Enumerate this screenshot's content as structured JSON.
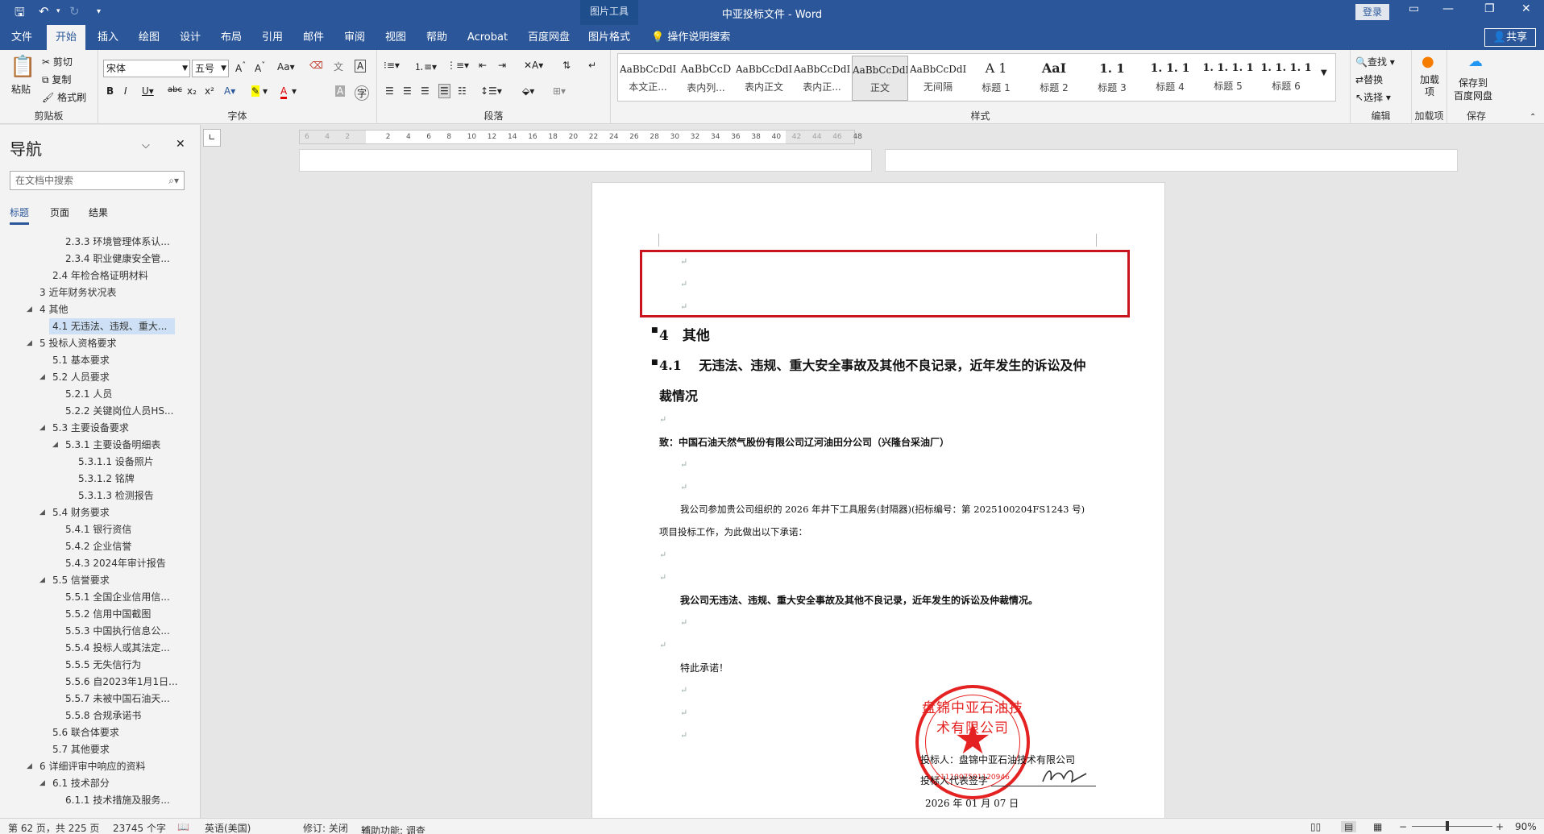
{
  "titlebar": {
    "context_tab": "图片工具",
    "doc_title": "中亚投标文件 - Word",
    "login": "登录",
    "share": "共享"
  },
  "tabs": [
    {
      "label": "文件"
    },
    {
      "label": "开始"
    },
    {
      "label": "插入"
    },
    {
      "label": "绘图"
    },
    {
      "label": "设计"
    },
    {
      "label": "布局"
    },
    {
      "label": "引用"
    },
    {
      "label": "邮件"
    },
    {
      "label": "审阅"
    },
    {
      "label": "视图"
    },
    {
      "label": "帮助"
    },
    {
      "label": "Acrobat"
    },
    {
      "label": "百度网盘"
    },
    {
      "label": "图片格式"
    }
  ],
  "tell_me": "操作说明搜索",
  "ribbon": {
    "clipboard": {
      "label": "剪贴板",
      "paste": "粘贴",
      "cut": "剪切",
      "copy": "复制",
      "format_painter": "格式刷"
    },
    "font": {
      "label": "字体",
      "font_name": "宋体",
      "font_size": "五号"
    },
    "paragraph": {
      "label": "段落"
    },
    "styles": {
      "label": "样式",
      "items": [
        {
          "preview": "AaBbCcDdI",
          "name": "本文正..."
        },
        {
          "preview": "AaBbCcD",
          "name": "表内列..."
        },
        {
          "preview": "AaBbCcDdI",
          "name": "表内正文"
        },
        {
          "preview": "AaBbCcDdI",
          "name": "表内正..."
        },
        {
          "preview": "AaBbCcDdI",
          "name": "正文"
        },
        {
          "preview": "AaBbCcDdI",
          "name": "无间隔"
        },
        {
          "preview": "A 1",
          "name": "标题 1"
        },
        {
          "preview": "AaI",
          "name": "标题 2"
        },
        {
          "preview": "1. 1",
          "name": "标题 3"
        },
        {
          "preview": "1. 1. 1",
          "name": "标题 4"
        },
        {
          "preview": "1. 1. 1. 1",
          "name": "标题 5"
        },
        {
          "preview": "1. 1. 1. 1",
          "name": "标题 6"
        }
      ]
    },
    "editing": {
      "label": "编辑",
      "find": "查找",
      "replace": "替换",
      "select": "选择"
    },
    "addins": {
      "label": "加载项",
      "btn": "加载项"
    },
    "save": {
      "label": "保存",
      "btn1": "保存到",
      "btn2": "百度网盘"
    }
  },
  "nav": {
    "title": "导航",
    "search_placeholder": "在文档中搜索",
    "tabs": [
      "标题",
      "页面",
      "结果"
    ],
    "items": [
      {
        "text": "2.3.3 环境管理体系认..."
      },
      {
        "text": "2.3.4 职业健康安全管..."
      },
      {
        "text": "2.4 年检合格证明材料"
      },
      {
        "text": "3 近年财务状况表"
      },
      {
        "text": "4 其他"
      },
      {
        "text": "4.1 无违法、违规、重大..."
      },
      {
        "text": "5 投标人资格要求"
      },
      {
        "text": "5.1 基本要求"
      },
      {
        "text": "5.2 人员要求"
      },
      {
        "text": "5.2.1 人员"
      },
      {
        "text": "5.2.2 关键岗位人员HS..."
      },
      {
        "text": "5.3 主要设备要求"
      },
      {
        "text": "5.3.1 主要设备明细表"
      },
      {
        "text": "5.3.1.1 设备照片"
      },
      {
        "text": "5.3.1.2 铭牌"
      },
      {
        "text": "5.3.1.3 检测报告"
      },
      {
        "text": "5.4 财务要求"
      },
      {
        "text": "5.4.1 银行资信"
      },
      {
        "text": "5.4.2 企业信誉"
      },
      {
        "text": "5.4.3 2024年审计报告"
      },
      {
        "text": "5.5 信誉要求"
      },
      {
        "text": "5.5.1 全国企业信用信..."
      },
      {
        "text": "5.5.2 信用中国截图"
      },
      {
        "text": "5.5.3 中国执行信息公..."
      },
      {
        "text": "5.5.4 投标人或其法定..."
      },
      {
        "text": "5.5.5 无失信行为"
      },
      {
        "text": "5.5.6 自2023年1月1日..."
      },
      {
        "text": "5.5.7 未被中国石油天..."
      },
      {
        "text": "5.5.8 合规承诺书"
      },
      {
        "text": "5.6 联合体要求"
      },
      {
        "text": "5.7 其他要求"
      },
      {
        "text": "6 详细评审中响应的资料"
      },
      {
        "text": "6.1 技术部分"
      },
      {
        "text": "6.1.1 技术措施及服务..."
      }
    ]
  },
  "ruler": {
    "ticks": [
      "6",
      "4",
      "2",
      "",
      "2",
      "4",
      "6",
      "8",
      "10",
      "12",
      "14",
      "16",
      "18",
      "20",
      "22",
      "24",
      "26",
      "28",
      "30",
      "32",
      "34",
      "36",
      "38",
      "40",
      "42",
      "44",
      "46",
      "48"
    ]
  },
  "document": {
    "heading1": "4　其他",
    "heading2_line1": "4.1　 无违法、违规、重大安全事故及其他不良记录，近年发生的诉讼及仲",
    "heading2_line2": "裁情况",
    "to_line": "致：中国石油天然气股份有限公司辽河油田分公司（兴隆台采油厂）",
    "para1_line1": "我公司参加贵公司组织的 2026 年井下工具服务(封隔器)(招标编号：第 2025100204FS1243 号)",
    "para1_line2": "项目投标工作，为此做出以下承诺：",
    "commitment": "我公司无违法、违规、重大安全事故及其他不良记录，近年发生的诉讼及仲裁情况。",
    "special": "特此承诺！",
    "bidder": "投标人：盘锦中亚石油技术有限公司",
    "rep": "投标人代表签字",
    "date": "2026 年 01 月 07 日",
    "pilcrow": "↵",
    "stamp_text": "盘锦中亚石油技术有限公司",
    "stamp_num": "2111007591120946"
  },
  "status": {
    "page": "第 62 页，共 225 页",
    "words": "23745 个字",
    "lang": "英语(美国)",
    "track": "修订: 关闭",
    "access": "辅助功能: 调查",
    "zoom": "90%"
  },
  "colors": {
    "brand": "#2b579a",
    "highlight_box": "#c9141f",
    "stamp": "#e52222"
  }
}
